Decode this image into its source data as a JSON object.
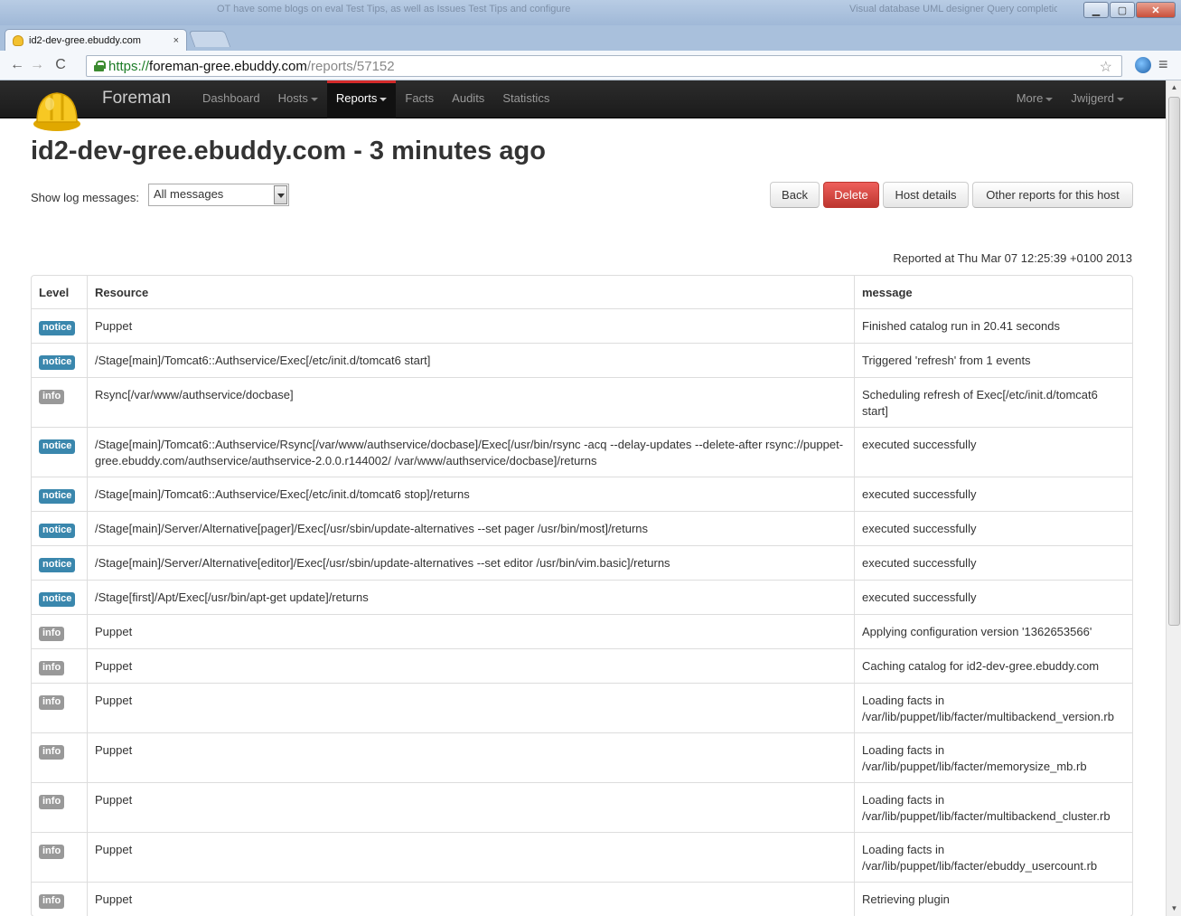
{
  "browser": {
    "tab_title": "id2-dev-gree.ebuddy.com",
    "tab_close": "×",
    "url_scheme": "https://",
    "url_host": "foreman-gree.ebuddy.com",
    "url_path": "/reports/57152",
    "background_window_text_1": "OT have some blogs on eval Test Tips, as well as Issues Test Tips and configure",
    "background_window_text_2": "Visual database UML designer Query completion,"
  },
  "navbar": {
    "brand": "Foreman",
    "items": [
      {
        "label": "Dashboard",
        "dropdown": false,
        "active": false
      },
      {
        "label": "Hosts",
        "dropdown": true,
        "active": false
      },
      {
        "label": "Reports",
        "dropdown": true,
        "active": true
      },
      {
        "label": "Facts",
        "dropdown": false,
        "active": false
      },
      {
        "label": "Audits",
        "dropdown": false,
        "active": false
      },
      {
        "label": "Statistics",
        "dropdown": false,
        "active": false
      }
    ],
    "right_items": [
      {
        "label": "More"
      },
      {
        "label": "Jwijgerd"
      }
    ]
  },
  "page": {
    "title": "id2-dev-gree.ebuddy.com - 3 minutes ago",
    "filter_label": "Show log messages:",
    "filter_value": "All messages",
    "buttons": {
      "back": "Back",
      "delete": "Delete",
      "host_details": "Host details",
      "other_reports": "Other reports for this host"
    },
    "reported_at": "Reported at Thu Mar 07 12:25:39 +0100 2013"
  },
  "table": {
    "headers": [
      "Level",
      "Resource",
      "message"
    ],
    "rows": [
      {
        "level": "notice",
        "resource": "Puppet",
        "message": "Finished catalog run in 20.41 seconds"
      },
      {
        "level": "notice",
        "resource": "/Stage[main]/Tomcat6::Authservice/Exec[/etc/init.d/tomcat6 start]",
        "message": "Triggered 'refresh' from 1 events"
      },
      {
        "level": "info",
        "resource": "Rsync[/var/www/authservice/docbase]",
        "message": "Scheduling refresh of Exec[/etc/init.d/tomcat6 start]"
      },
      {
        "level": "notice",
        "resource": "/Stage[main]/Tomcat6::Authservice/Rsync[/var/www/authservice/docbase]/Exec[/usr/bin/rsync -acq --delay-updates --delete-after rsync://puppet-gree.ebuddy.com/authservice/authservice-2.0.0.r144002/ /var/www/authservice/docbase]/returns",
        "message": "executed successfully"
      },
      {
        "level": "notice",
        "resource": "/Stage[main]/Tomcat6::Authservice/Exec[/etc/init.d/tomcat6 stop]/returns",
        "message": "executed successfully"
      },
      {
        "level": "notice",
        "resource": "/Stage[main]/Server/Alternative[pager]/Exec[/usr/sbin/update-alternatives --set pager /usr/bin/most]/returns",
        "message": "executed successfully"
      },
      {
        "level": "notice",
        "resource": "/Stage[main]/Server/Alternative[editor]/Exec[/usr/sbin/update-alternatives --set editor /usr/bin/vim.basic]/returns",
        "message": "executed successfully"
      },
      {
        "level": "notice",
        "resource": "/Stage[first]/Apt/Exec[/usr/bin/apt-get update]/returns",
        "message": "executed successfully"
      },
      {
        "level": "info",
        "resource": "Puppet",
        "message": "Applying configuration version '1362653566'"
      },
      {
        "level": "info",
        "resource": "Puppet",
        "message": "Caching catalog for id2-dev-gree.ebuddy.com"
      },
      {
        "level": "info",
        "resource": "Puppet",
        "message": "Loading facts in /var/lib/puppet/lib/facter/multibackend_version.rb"
      },
      {
        "level": "info",
        "resource": "Puppet",
        "message": "Loading facts in /var/lib/puppet/lib/facter/memorysize_mb.rb"
      },
      {
        "level": "info",
        "resource": "Puppet",
        "message": "Loading facts in /var/lib/puppet/lib/facter/multibackend_cluster.rb"
      },
      {
        "level": "info",
        "resource": "Puppet",
        "message": "Loading facts in /var/lib/puppet/lib/facter/ebuddy_usercount.rb"
      },
      {
        "level": "info",
        "resource": "Puppet",
        "message": "Retrieving plugin"
      }
    ]
  },
  "colors": {
    "notice": "#3a87ad",
    "info": "#999999",
    "danger": "#d9534f",
    "navbar": "#1b1b1b",
    "active_indicator": "#d32a2a"
  }
}
